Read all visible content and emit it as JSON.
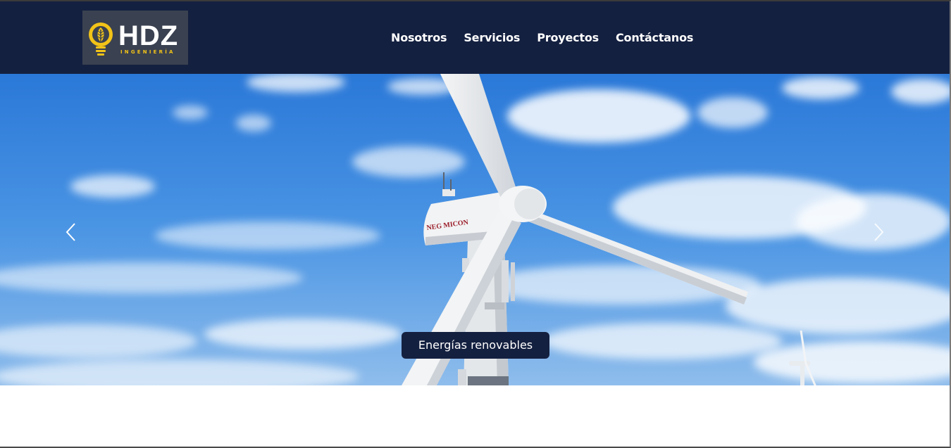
{
  "brand": {
    "name": "HDZ",
    "subtitle": "INGENIERÍA",
    "accent_color": "#f2c318",
    "nav_bg": "#142040"
  },
  "nav": {
    "items": [
      {
        "label": "Nosotros"
      },
      {
        "label": "Servicios"
      },
      {
        "label": "Proyectos"
      },
      {
        "label": "Contáctanos"
      }
    ]
  },
  "carousel": {
    "caption": "Energías renovables",
    "turbine_brand": "NEG MICON",
    "prev_icon": "chevron-left-icon",
    "next_icon": "chevron-right-icon"
  }
}
